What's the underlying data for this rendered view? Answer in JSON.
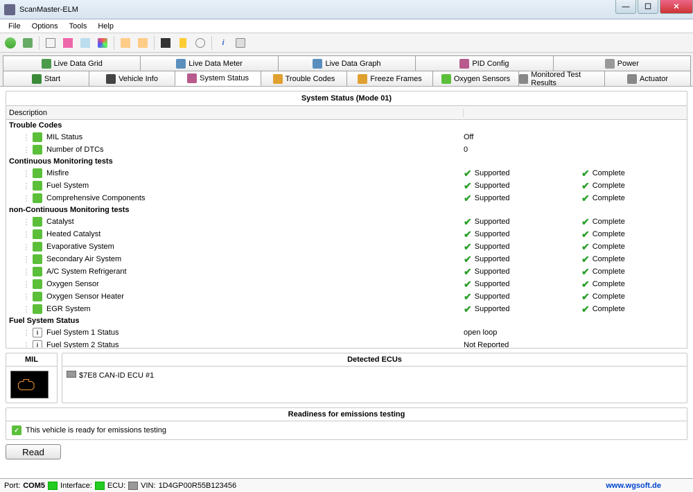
{
  "window": {
    "title": "ScanMaster-ELM"
  },
  "menu": [
    "File",
    "Options",
    "Tools",
    "Help"
  ],
  "tabs_row1": [
    {
      "label": "Live Data Grid",
      "icon": "#4b9b4b"
    },
    {
      "label": "Live Data Meter",
      "icon": "#5a8fbd"
    },
    {
      "label": "Live Data Graph",
      "icon": "#5a8fbd"
    },
    {
      "label": "PID Config",
      "icon": "#b85a8d"
    },
    {
      "label": "Power",
      "icon": "#999"
    }
  ],
  "tabs_row2": [
    {
      "label": "Start",
      "icon": "#3a8a3a",
      "active": false
    },
    {
      "label": "Vehicle Info",
      "icon": "#444",
      "active": false
    },
    {
      "label": "System Status",
      "icon": "#b85a8d",
      "active": true
    },
    {
      "label": "Trouble Codes",
      "icon": "#e0a030",
      "active": false
    },
    {
      "label": "Freeze Frames",
      "icon": "#e0a030",
      "active": false
    },
    {
      "label": "Oxygen Sensors",
      "icon": "#5bbf3a",
      "active": false
    },
    {
      "label": "Monitored Test Results",
      "icon": "#888",
      "active": false
    },
    {
      "label": "Actuator",
      "icon": "#888",
      "active": false
    }
  ],
  "panel": {
    "title": "System Status (Mode 01)",
    "desc_header": "Description"
  },
  "grid": {
    "sections": [
      {
        "title": "Trouble Codes",
        "items": [
          {
            "label": "MIL Status",
            "v1": "Off",
            "v2": ""
          },
          {
            "label": "Number of DTCs",
            "v1": "0",
            "v2": ""
          }
        ]
      },
      {
        "title": "Continuous Monitoring tests",
        "items": [
          {
            "label": "Misfire",
            "v1": "Supported",
            "v2": "Complete",
            "check": true
          },
          {
            "label": "Fuel System",
            "v1": "Supported",
            "v2": "Complete",
            "check": true
          },
          {
            "label": "Comprehensive Components",
            "v1": "Supported",
            "v2": "Complete",
            "check": true
          }
        ]
      },
      {
        "title": "non-Continuous Monitoring tests",
        "items": [
          {
            "label": "Catalyst",
            "v1": "Supported",
            "v2": "Complete",
            "check": true
          },
          {
            "label": "Heated Catalyst",
            "v1": "Supported",
            "v2": "Complete",
            "check": true
          },
          {
            "label": "Evaporative System",
            "v1": "Supported",
            "v2": "Complete",
            "check": true
          },
          {
            "label": "Secondary Air System",
            "v1": "Supported",
            "v2": "Complete",
            "check": true
          },
          {
            "label": "A/C System Refrigerant",
            "v1": "Supported",
            "v2": "Complete",
            "check": true
          },
          {
            "label": "Oxygen Sensor",
            "v1": "Supported",
            "v2": "Complete",
            "check": true
          },
          {
            "label": "Oxygen Sensor Heater",
            "v1": "Supported",
            "v2": "Complete",
            "check": true
          },
          {
            "label": "EGR System",
            "v1": "Supported",
            "v2": "Complete",
            "check": true
          }
        ]
      },
      {
        "title": "Fuel System Status",
        "items": [
          {
            "label": "Fuel System 1 Status",
            "v1": "open loop",
            "v2": "",
            "info": true
          },
          {
            "label": "Fuel System 2 Status",
            "v1": "Not Reported",
            "v2": "",
            "info": true
          }
        ]
      }
    ]
  },
  "mil": {
    "label": "MIL"
  },
  "ecus": {
    "title": "Detected ECUs",
    "item": "$7E8   CAN-ID ECU #1"
  },
  "readiness": {
    "title": "Readiness for emissions testing",
    "text": "This vehicle is ready for emissions testing"
  },
  "read_btn": "Read",
  "status": {
    "port_label": "Port:",
    "port": "COM5",
    "iface_label": "Interface:",
    "ecu_label": "ECU:",
    "vin_label": "VIN:",
    "vin": "1D4GP00R55B123456",
    "url": "www.wgsoft.de"
  }
}
